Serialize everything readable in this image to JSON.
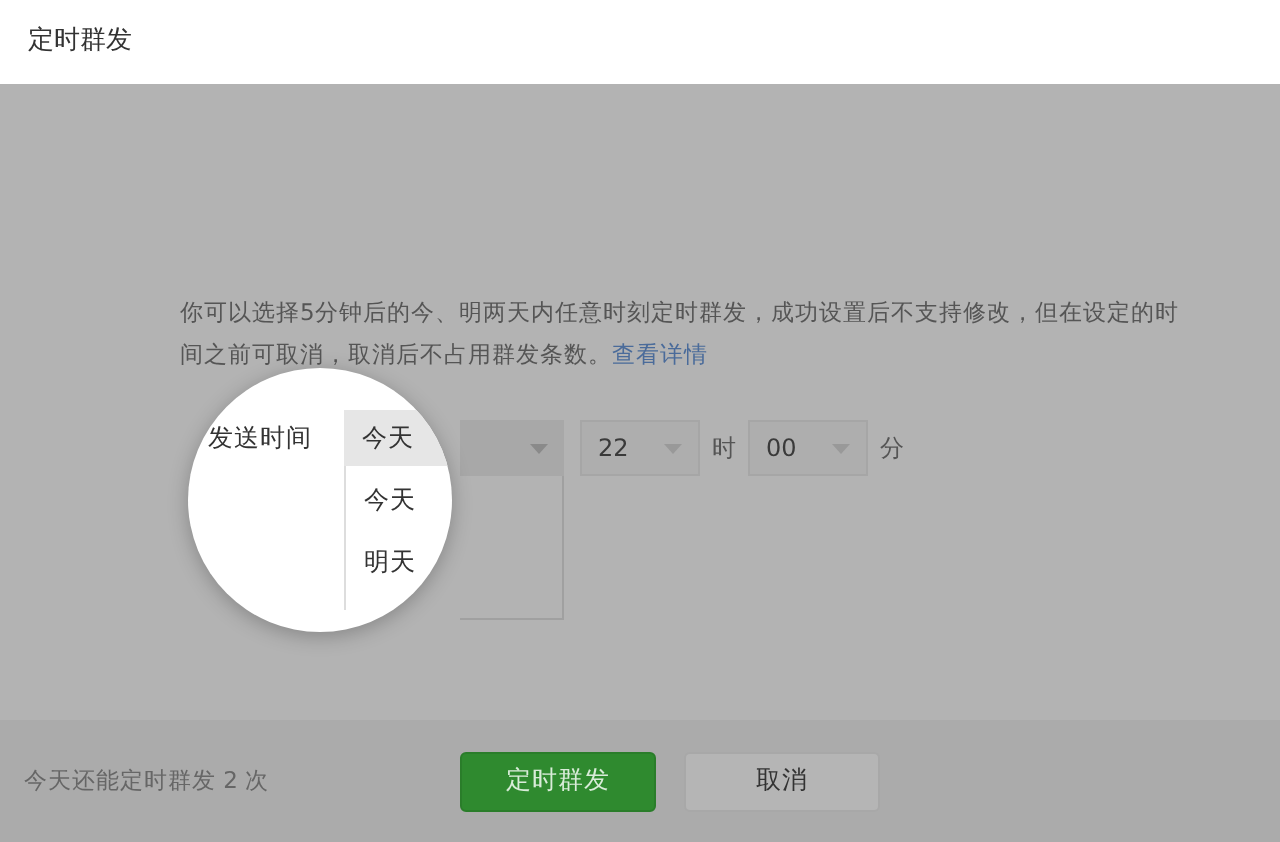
{
  "window": {
    "title": "定时群发"
  },
  "notice": {
    "text": "你可以选择5分钟后的今、明两天内任意时刻定时群发，成功设置后不支持修改，但在设定的时间之前可取消，取消后不占用群发条数。",
    "link": "查看详情"
  },
  "send_time": {
    "label": "发送时间",
    "day": {
      "value": "今天",
      "expanded": true,
      "options": [
        "今天",
        "明天"
      ]
    },
    "hour": {
      "value": "22",
      "unit": "时"
    },
    "minute": {
      "value": "00",
      "unit": "分"
    }
  },
  "footer": {
    "remaining": "今天还能定时群发 2 次",
    "buttons": [
      {
        "label": "定时群发",
        "kind": "primary"
      },
      {
        "label": "取消",
        "kind": "secondary"
      }
    ]
  }
}
